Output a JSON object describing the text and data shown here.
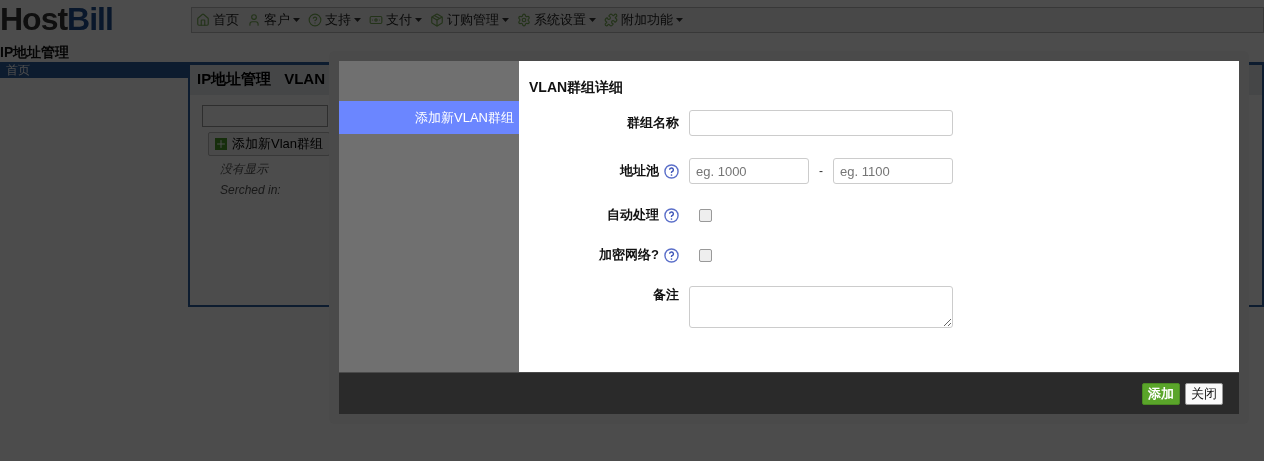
{
  "logo": {
    "part_1": "Host",
    "part_2": "Bill"
  },
  "menu": [
    {
      "label": "首页",
      "dropdown": false
    },
    {
      "label": "客户",
      "dropdown": true
    },
    {
      "label": "支持",
      "dropdown": true
    },
    {
      "label": "支付",
      "dropdown": true
    },
    {
      "label": "订购管理",
      "dropdown": true
    },
    {
      "label": "系统设置",
      "dropdown": true
    },
    {
      "label": "附加功能",
      "dropdown": true
    }
  ],
  "page_title": "IP地址管理",
  "breadcrumb": "首页",
  "tabs": [
    {
      "label": "IP地址管理"
    },
    {
      "label": "VLAN"
    }
  ],
  "add_button": "添加新Vlan群组",
  "empty_text": "没有显示",
  "searched_text": "Serched in:",
  "modal": {
    "sidebar": [
      {
        "label": "添加新VLAN群组",
        "selected": true
      }
    ],
    "title": "VLAN群组详细",
    "fields": [
      {
        "kind": "text",
        "label": "群组名称",
        "help": false
      },
      {
        "kind": "range",
        "label": "地址池",
        "help": true,
        "placeholder_from": "eg. 1000",
        "separator": "-",
        "placeholder_to": "eg. 1100"
      },
      {
        "kind": "checkbox",
        "label": "自动处理",
        "help": true,
        "checked": false
      },
      {
        "kind": "checkbox",
        "label": "加密网络?",
        "help": true,
        "checked": false
      },
      {
        "kind": "textarea",
        "label": "备注",
        "help": false
      }
    ],
    "buttons": [
      {
        "label": "添加",
        "kind": "primary"
      },
      {
        "label": "关闭",
        "kind": "default"
      }
    ]
  }
}
